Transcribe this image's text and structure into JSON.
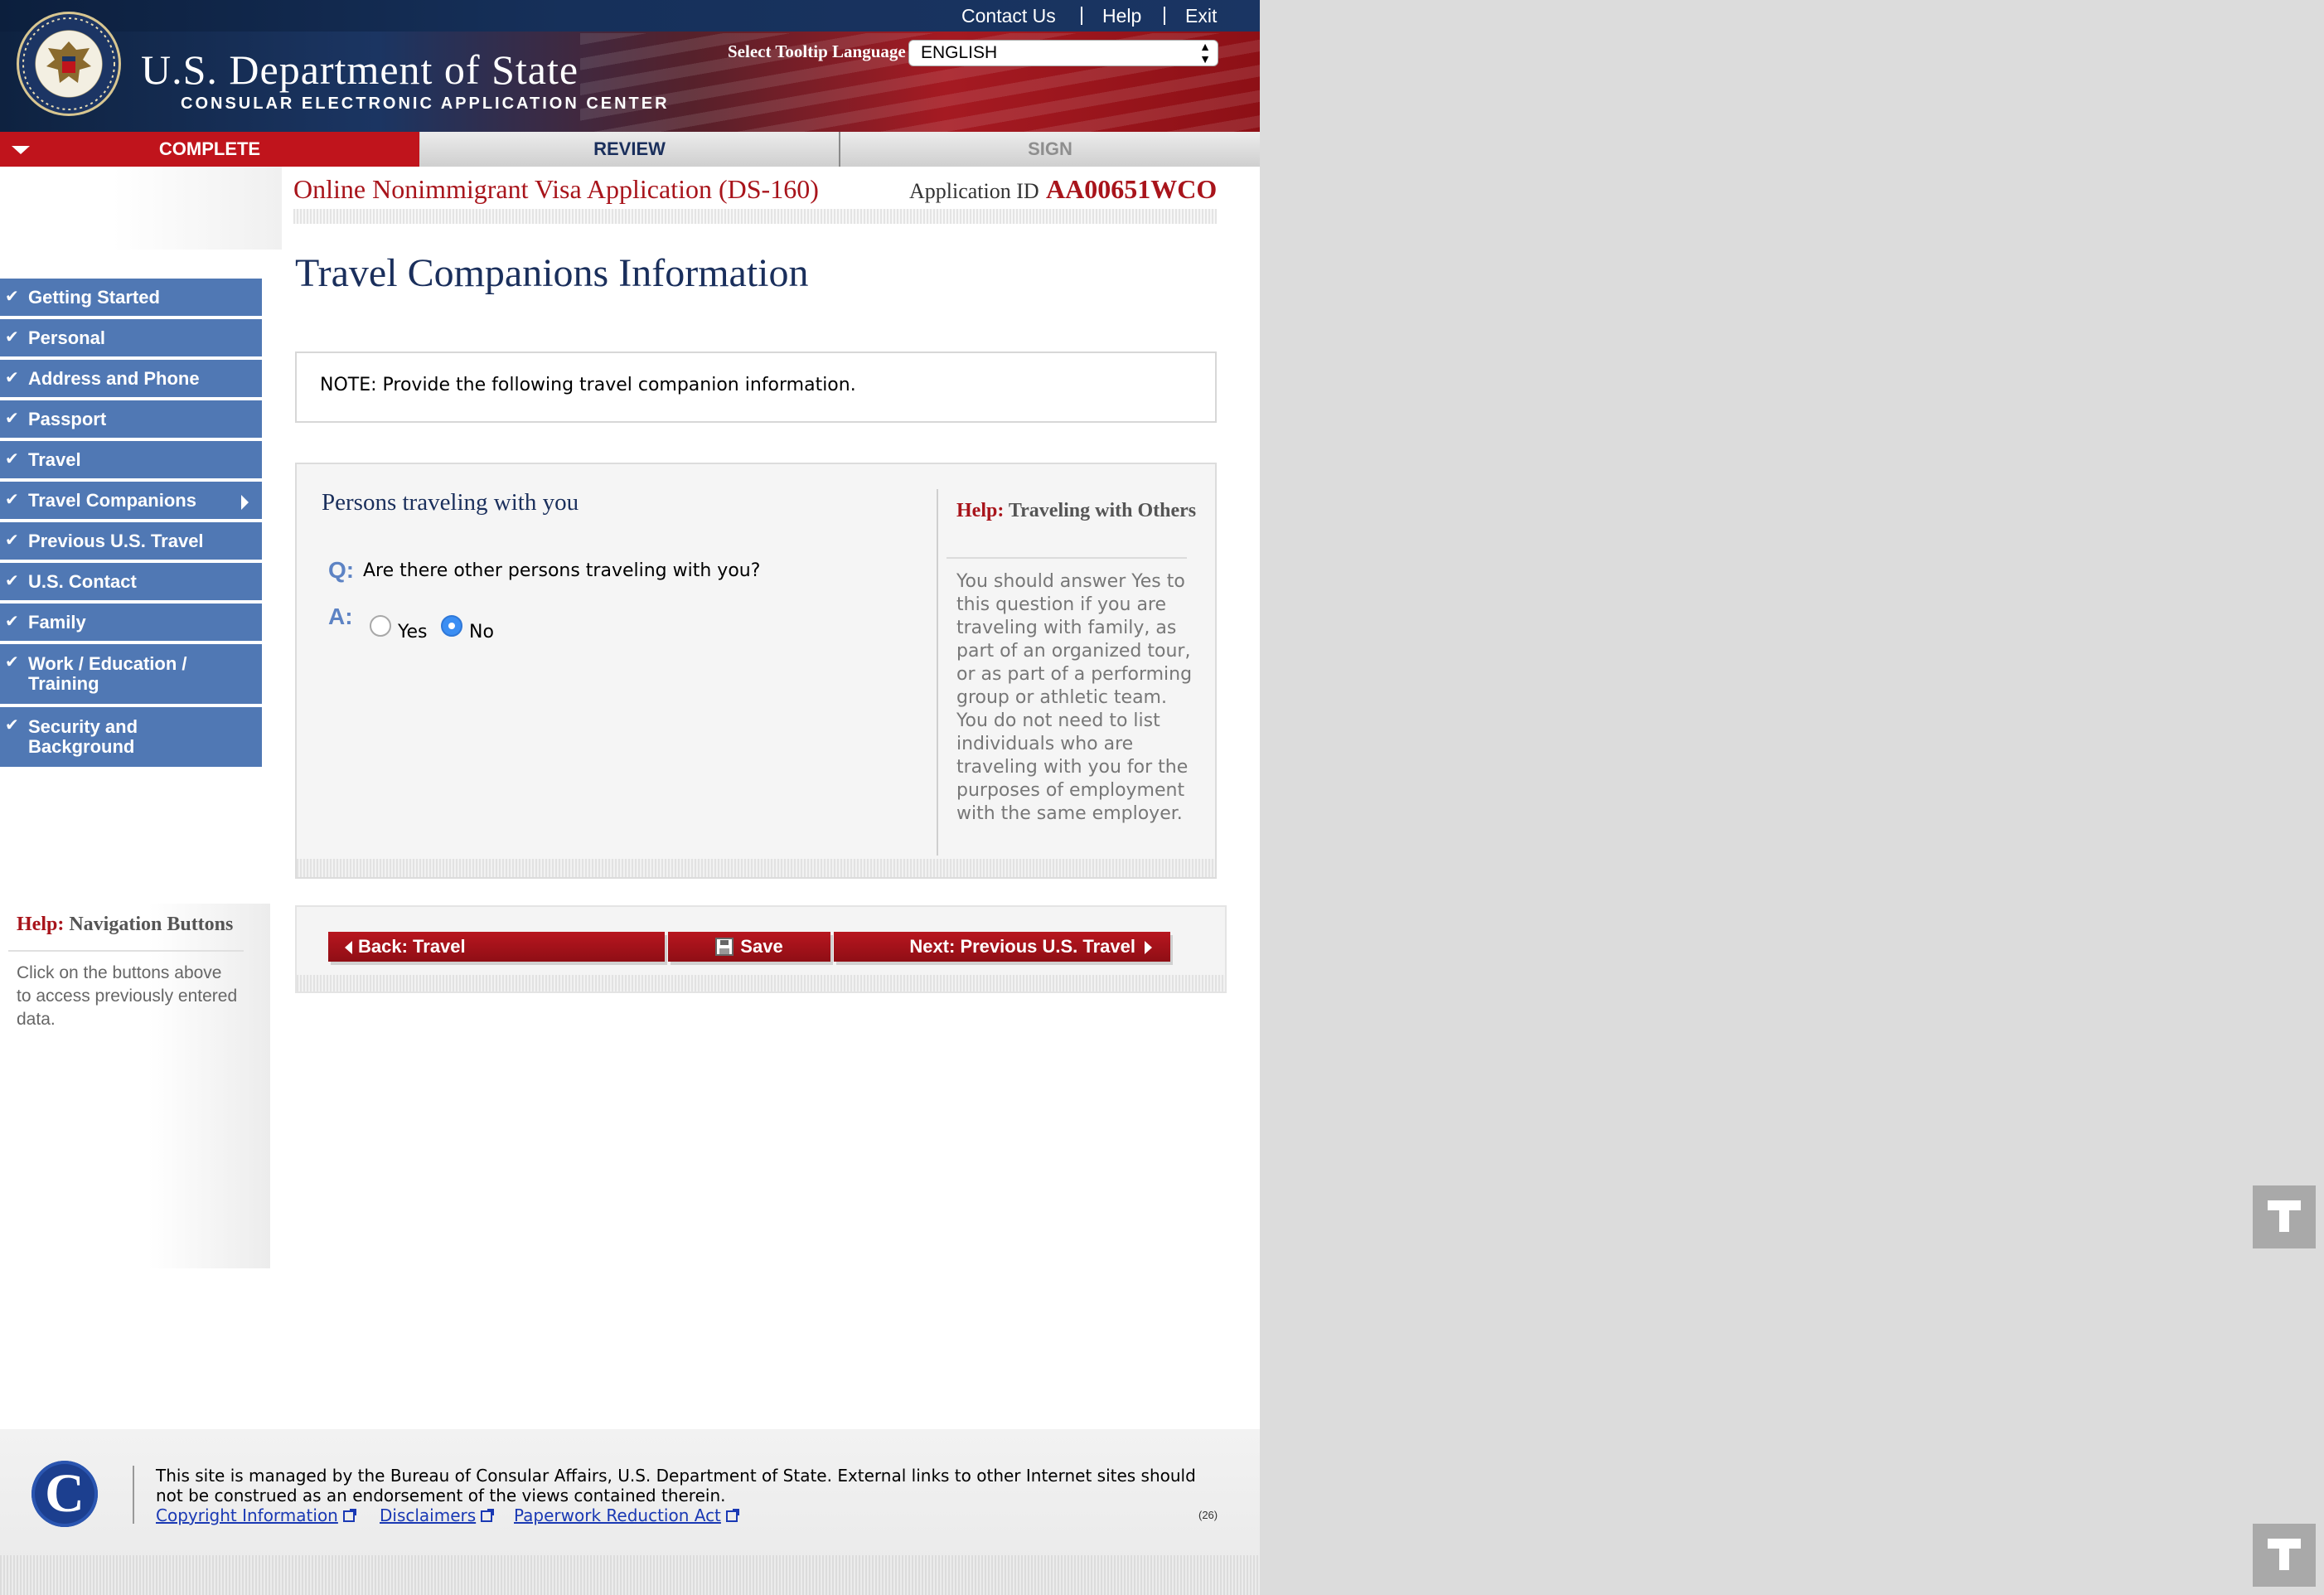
{
  "header": {
    "links": [
      "Contact Us",
      "Help",
      "Exit"
    ],
    "title_line1": "U.S. Department of State",
    "title_line2": "CONSULAR ELECTRONIC APPLICATION CENTER",
    "language_label": "Select Tooltip Language",
    "language_value": "ENGLISH"
  },
  "steps": [
    "COMPLETE",
    "REVIEW",
    "SIGN"
  ],
  "app": {
    "title": "Online Nonimmigrant Visa Application (DS-160)",
    "id_label": "Application ID",
    "id_value": "AA00651WCO"
  },
  "sidebar": {
    "items": [
      {
        "label": "Getting Started"
      },
      {
        "label": "Personal"
      },
      {
        "label": "Address and Phone"
      },
      {
        "label": "Passport"
      },
      {
        "label": "Travel"
      },
      {
        "label": "Travel Companions"
      },
      {
        "label": "Previous U.S. Travel"
      },
      {
        "label": "U.S. Contact"
      },
      {
        "label": "Family"
      },
      {
        "label": "Work / Education / Training"
      },
      {
        "label": "Security and Background"
      }
    ],
    "current_index": 5
  },
  "main": {
    "heading": "Travel Companions Information",
    "note": "NOTE: Provide the following travel companion information.",
    "section_title": "Persons traveling with you",
    "question_label": "Q:",
    "question": "Are there other persons traveling with you?",
    "answer_label": "A:",
    "options": [
      "Yes",
      "No"
    ],
    "selected": "No",
    "help": {
      "prefix": "Help:",
      "title": "Traveling with Others",
      "body": "You should answer Yes to this question if you are traveling with family, as part of an organized tour, or as part of a performing group or athletic team. You do not need to list individuals who are traveling with you for the purposes of employment with the same employer."
    }
  },
  "nav_help": {
    "prefix": "Help:",
    "title": "Navigation Buttons",
    "body": "Click on the buttons above to access previously entered data."
  },
  "buttons": {
    "back": "Back: Travel",
    "save": "Save",
    "next": "Next: Previous U.S. Travel"
  },
  "footer": {
    "text": "This site is managed by the Bureau of Consular Affairs, U.S. Department of State. External links to other Internet sites should not be construed as an endorsement of the views contained therein.",
    "links": [
      "Copyright Information",
      "Disclaimers",
      "Paperwork Reduction Act"
    ],
    "page_code": "(26)"
  },
  "colors": {
    "navy": "#1a2f5c",
    "accent_red": "#a8141b",
    "nav_blue": "#5078b4",
    "radio_selected": "#3b8ef3"
  }
}
